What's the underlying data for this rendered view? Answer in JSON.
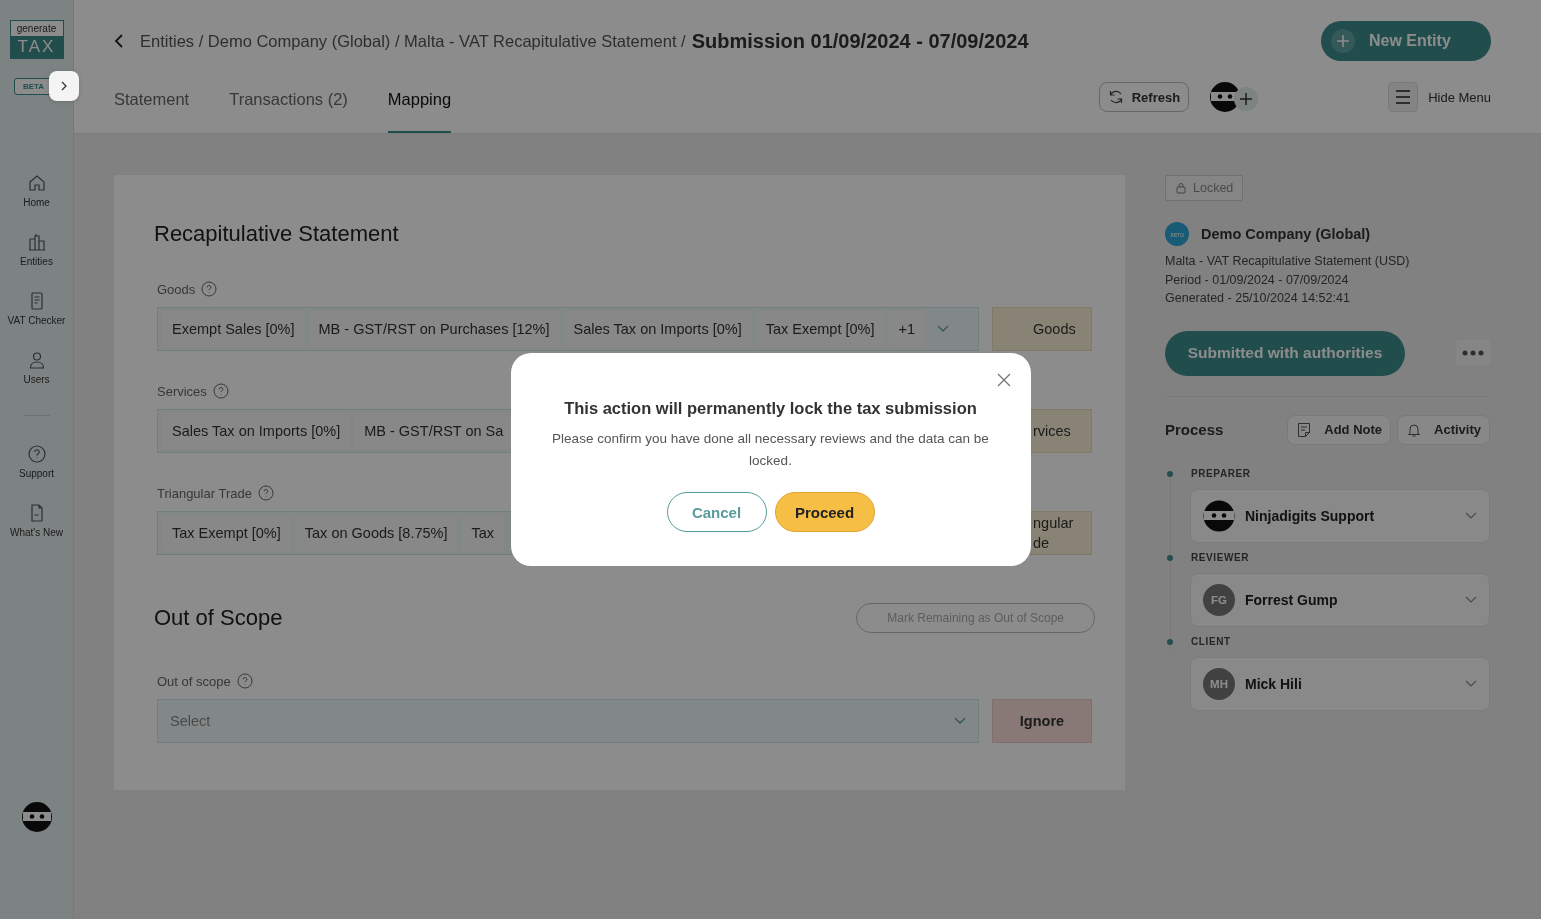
{
  "logo": {
    "top": "generate",
    "bottom": "TAX",
    "badge": "BETA"
  },
  "nav_main": [
    "Home",
    "Entities",
    "VAT Checker",
    "Users"
  ],
  "nav_secondary": [
    "Support",
    "What's New"
  ],
  "breadcrumb": {
    "path": "Entities / Demo Company (Global) / Malta - VAT Recapitulative Statement /",
    "current": "Submission 01/09/2024 - 07/09/2024"
  },
  "new_entity_button": "New Entity",
  "tabs": [
    {
      "label": "Statement",
      "selected": false
    },
    {
      "label": "Transactions (2)",
      "selected": false
    },
    {
      "label": "Mapping",
      "selected": true
    }
  ],
  "refresh_button": "Refresh",
  "hide_menu_button": "Hide Menu",
  "section_title": "Recapitulative Statement",
  "mappings": [
    {
      "label": "Goods",
      "chips": [
        "Exempt Sales [0%]",
        "MB - GST/RST on Purchases [12%]",
        "Sales Tax on Imports [0%]",
        "Tax Exempt [0%]"
      ],
      "more": "+1",
      "button_lines": [
        "Goods"
      ]
    },
    {
      "label": "Services",
      "chips": [
        "Sales Tax on Imports [0%]",
        "MB - GST/RST on Sa"
      ],
      "button_lines": [
        "rvices"
      ]
    },
    {
      "label": "Triangular Trade",
      "chips": [
        "Tax Exempt [0%]",
        "Tax on Goods [8.75%]",
        "Tax"
      ],
      "button_lines": [
        "ngular",
        "de"
      ]
    }
  ],
  "out_of_scope": {
    "title": "Out of Scope",
    "action": "Mark Remaining as Out of Scope",
    "field_label": "Out of scope",
    "placeholder": "Select",
    "button": "Ignore"
  },
  "summary": {
    "status": "Locked",
    "company": "Demo Company (Global)",
    "source_badge": "xero",
    "lines": [
      "Malta - VAT Recapitulative Statement (USD)",
      "Period - 01/09/2024 - 07/09/2024",
      "Generated - 25/10/2024 14:52:41"
    ],
    "primary_button": "Submitted with authorities"
  },
  "process": {
    "title": "Process",
    "buttons": [
      {
        "label": "Add Note",
        "kind": "note"
      },
      {
        "label": "Activity",
        "kind": "bell"
      }
    ],
    "steps": [
      {
        "role": "PREPARER",
        "name": "Ninjadigits Support"
      },
      {
        "role": "REVIEWER",
        "name": "Forrest Gump",
        "initials": "FG"
      },
      {
        "role": "CLIENT",
        "name": "Mick Hili",
        "initials": "MH"
      }
    ]
  },
  "dialog": {
    "title": "This action will permanently lock the tax submission",
    "message": "Please confirm you have done all necessary reviews and the data can be locked.",
    "buttons": [
      {
        "label": "Cancel",
        "kind": "secondary"
      },
      {
        "label": "Proceed",
        "kind": "primary"
      }
    ]
  }
}
